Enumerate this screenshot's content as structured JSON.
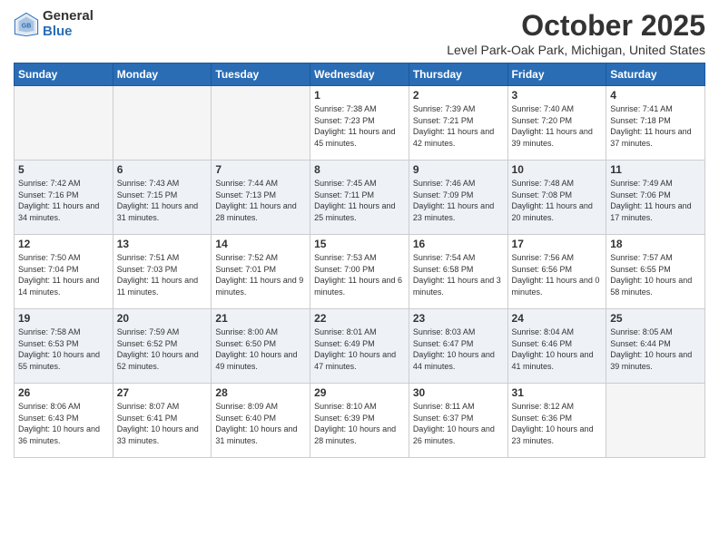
{
  "logo": {
    "general": "General",
    "blue": "Blue"
  },
  "header": {
    "month": "October 2025",
    "location": "Level Park-Oak Park, Michigan, United States"
  },
  "weekdays": [
    "Sunday",
    "Monday",
    "Tuesday",
    "Wednesday",
    "Thursday",
    "Friday",
    "Saturday"
  ],
  "weeks": [
    [
      {
        "day": "",
        "sunrise": "",
        "sunset": "",
        "daylight": ""
      },
      {
        "day": "",
        "sunrise": "",
        "sunset": "",
        "daylight": ""
      },
      {
        "day": "",
        "sunrise": "",
        "sunset": "",
        "daylight": ""
      },
      {
        "day": "1",
        "sunrise": "Sunrise: 7:38 AM",
        "sunset": "Sunset: 7:23 PM",
        "daylight": "Daylight: 11 hours and 45 minutes."
      },
      {
        "day": "2",
        "sunrise": "Sunrise: 7:39 AM",
        "sunset": "Sunset: 7:21 PM",
        "daylight": "Daylight: 11 hours and 42 minutes."
      },
      {
        "day": "3",
        "sunrise": "Sunrise: 7:40 AM",
        "sunset": "Sunset: 7:20 PM",
        "daylight": "Daylight: 11 hours and 39 minutes."
      },
      {
        "day": "4",
        "sunrise": "Sunrise: 7:41 AM",
        "sunset": "Sunset: 7:18 PM",
        "daylight": "Daylight: 11 hours and 37 minutes."
      }
    ],
    [
      {
        "day": "5",
        "sunrise": "Sunrise: 7:42 AM",
        "sunset": "Sunset: 7:16 PM",
        "daylight": "Daylight: 11 hours and 34 minutes."
      },
      {
        "day": "6",
        "sunrise": "Sunrise: 7:43 AM",
        "sunset": "Sunset: 7:15 PM",
        "daylight": "Daylight: 11 hours and 31 minutes."
      },
      {
        "day": "7",
        "sunrise": "Sunrise: 7:44 AM",
        "sunset": "Sunset: 7:13 PM",
        "daylight": "Daylight: 11 hours and 28 minutes."
      },
      {
        "day": "8",
        "sunrise": "Sunrise: 7:45 AM",
        "sunset": "Sunset: 7:11 PM",
        "daylight": "Daylight: 11 hours and 25 minutes."
      },
      {
        "day": "9",
        "sunrise": "Sunrise: 7:46 AM",
        "sunset": "Sunset: 7:09 PM",
        "daylight": "Daylight: 11 hours and 23 minutes."
      },
      {
        "day": "10",
        "sunrise": "Sunrise: 7:48 AM",
        "sunset": "Sunset: 7:08 PM",
        "daylight": "Daylight: 11 hours and 20 minutes."
      },
      {
        "day": "11",
        "sunrise": "Sunrise: 7:49 AM",
        "sunset": "Sunset: 7:06 PM",
        "daylight": "Daylight: 11 hours and 17 minutes."
      }
    ],
    [
      {
        "day": "12",
        "sunrise": "Sunrise: 7:50 AM",
        "sunset": "Sunset: 7:04 PM",
        "daylight": "Daylight: 11 hours and 14 minutes."
      },
      {
        "day": "13",
        "sunrise": "Sunrise: 7:51 AM",
        "sunset": "Sunset: 7:03 PM",
        "daylight": "Daylight: 11 hours and 11 minutes."
      },
      {
        "day": "14",
        "sunrise": "Sunrise: 7:52 AM",
        "sunset": "Sunset: 7:01 PM",
        "daylight": "Daylight: 11 hours and 9 minutes."
      },
      {
        "day": "15",
        "sunrise": "Sunrise: 7:53 AM",
        "sunset": "Sunset: 7:00 PM",
        "daylight": "Daylight: 11 hours and 6 minutes."
      },
      {
        "day": "16",
        "sunrise": "Sunrise: 7:54 AM",
        "sunset": "Sunset: 6:58 PM",
        "daylight": "Daylight: 11 hours and 3 minutes."
      },
      {
        "day": "17",
        "sunrise": "Sunrise: 7:56 AM",
        "sunset": "Sunset: 6:56 PM",
        "daylight": "Daylight: 11 hours and 0 minutes."
      },
      {
        "day": "18",
        "sunrise": "Sunrise: 7:57 AM",
        "sunset": "Sunset: 6:55 PM",
        "daylight": "Daylight: 10 hours and 58 minutes."
      }
    ],
    [
      {
        "day": "19",
        "sunrise": "Sunrise: 7:58 AM",
        "sunset": "Sunset: 6:53 PM",
        "daylight": "Daylight: 10 hours and 55 minutes."
      },
      {
        "day": "20",
        "sunrise": "Sunrise: 7:59 AM",
        "sunset": "Sunset: 6:52 PM",
        "daylight": "Daylight: 10 hours and 52 minutes."
      },
      {
        "day": "21",
        "sunrise": "Sunrise: 8:00 AM",
        "sunset": "Sunset: 6:50 PM",
        "daylight": "Daylight: 10 hours and 49 minutes."
      },
      {
        "day": "22",
        "sunrise": "Sunrise: 8:01 AM",
        "sunset": "Sunset: 6:49 PM",
        "daylight": "Daylight: 10 hours and 47 minutes."
      },
      {
        "day": "23",
        "sunrise": "Sunrise: 8:03 AM",
        "sunset": "Sunset: 6:47 PM",
        "daylight": "Daylight: 10 hours and 44 minutes."
      },
      {
        "day": "24",
        "sunrise": "Sunrise: 8:04 AM",
        "sunset": "Sunset: 6:46 PM",
        "daylight": "Daylight: 10 hours and 41 minutes."
      },
      {
        "day": "25",
        "sunrise": "Sunrise: 8:05 AM",
        "sunset": "Sunset: 6:44 PM",
        "daylight": "Daylight: 10 hours and 39 minutes."
      }
    ],
    [
      {
        "day": "26",
        "sunrise": "Sunrise: 8:06 AM",
        "sunset": "Sunset: 6:43 PM",
        "daylight": "Daylight: 10 hours and 36 minutes."
      },
      {
        "day": "27",
        "sunrise": "Sunrise: 8:07 AM",
        "sunset": "Sunset: 6:41 PM",
        "daylight": "Daylight: 10 hours and 33 minutes."
      },
      {
        "day": "28",
        "sunrise": "Sunrise: 8:09 AM",
        "sunset": "Sunset: 6:40 PM",
        "daylight": "Daylight: 10 hours and 31 minutes."
      },
      {
        "day": "29",
        "sunrise": "Sunrise: 8:10 AM",
        "sunset": "Sunset: 6:39 PM",
        "daylight": "Daylight: 10 hours and 28 minutes."
      },
      {
        "day": "30",
        "sunrise": "Sunrise: 8:11 AM",
        "sunset": "Sunset: 6:37 PM",
        "daylight": "Daylight: 10 hours and 26 minutes."
      },
      {
        "day": "31",
        "sunrise": "Sunrise: 8:12 AM",
        "sunset": "Sunset: 6:36 PM",
        "daylight": "Daylight: 10 hours and 23 minutes."
      },
      {
        "day": "",
        "sunrise": "",
        "sunset": "",
        "daylight": ""
      }
    ]
  ]
}
